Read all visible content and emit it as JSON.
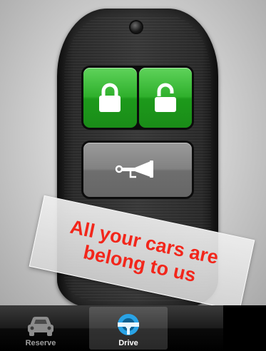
{
  "remote": {
    "lock_icon": "lock-icon",
    "unlock_icon": "unlock-icon",
    "horn_icon": "horn-icon",
    "button_color": "#2fb02c",
    "horn_button_color": "#828282"
  },
  "sticker": {
    "line1": "All your cars are",
    "line2": "belong to us",
    "color": "#f2261b"
  },
  "tabs": [
    {
      "label": "Reserve",
      "icon": "car-icon",
      "active": false
    },
    {
      "label": "Drive",
      "icon": "steering-wheel-icon",
      "active": true
    }
  ]
}
